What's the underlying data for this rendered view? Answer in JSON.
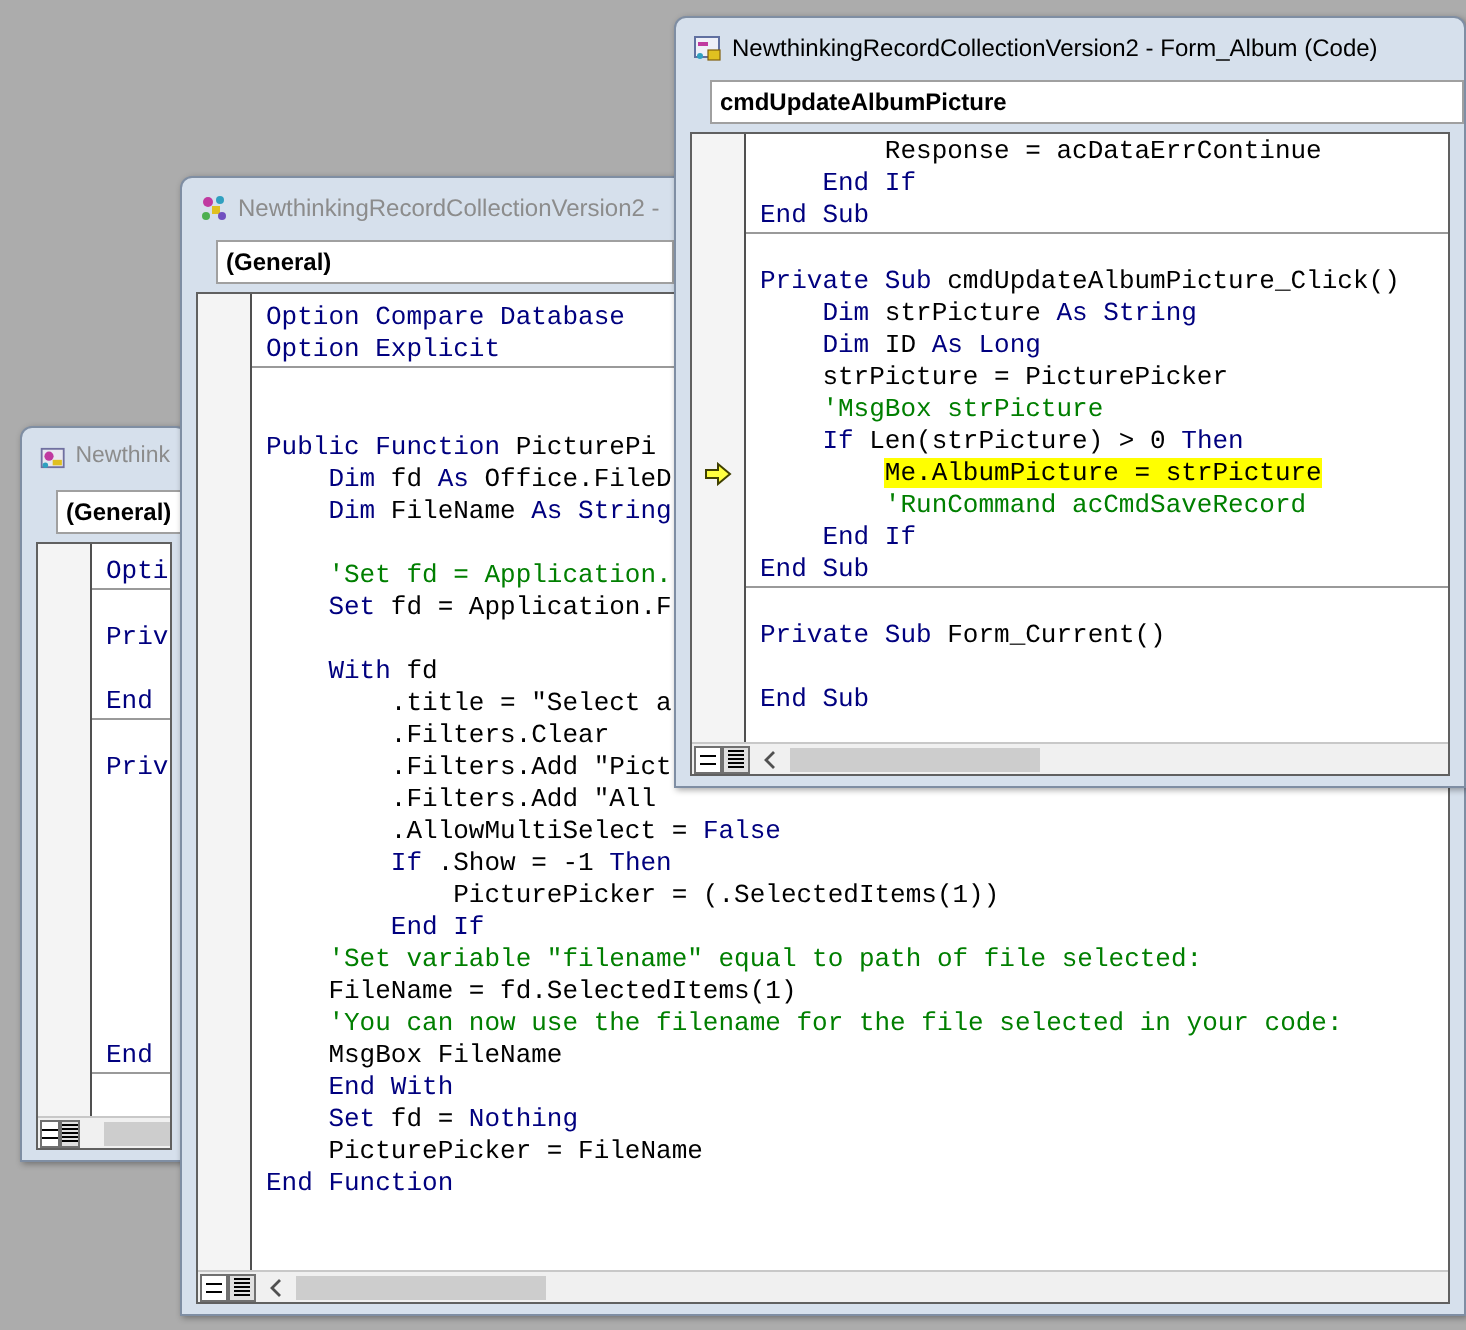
{
  "windows": [
    {
      "title": "Newthink",
      "active": false,
      "dropdown": "(General)",
      "blocks": [
        {
          "lines": [
            {
              "kind": "code",
              "segments": [
                {
                  "kind": "keyword",
                  "text": "Opti"
                }
              ]
            }
          ]
        },
        {
          "lines": [
            {
              "kind": "blank"
            },
            {
              "kind": "code",
              "segments": [
                {
                  "kind": "keyword",
                  "text": "Priv"
                }
              ]
            },
            {
              "kind": "blank"
            },
            {
              "kind": "code",
              "segments": [
                {
                  "kind": "keyword",
                  "text": "End"
                }
              ]
            }
          ]
        },
        {
          "lines": [
            {
              "kind": "blank"
            },
            {
              "kind": "code",
              "segments": [
                {
                  "kind": "keyword",
                  "text": "Priv"
                }
              ]
            },
            {
              "kind": "blank"
            },
            {
              "kind": "blank"
            },
            {
              "kind": "blank"
            },
            {
              "kind": "blank"
            },
            {
              "kind": "blank"
            },
            {
              "kind": "blank"
            },
            {
              "kind": "blank"
            },
            {
              "kind": "blank"
            },
            {
              "kind": "code",
              "segments": [
                {
                  "kind": "keyword",
                  "text": "End"
                }
              ]
            }
          ]
        },
        {
          "lines": [
            {
              "kind": "blank"
            }
          ]
        }
      ]
    },
    {
      "title": "NewthinkingRecordCollectionVersion2 -",
      "active": false,
      "dropdown": "(General)",
      "blocks": [
        {
          "lines": [
            {
              "kind": "code",
              "segments": [
                {
                  "kind": "keyword",
                  "text": "Option Compare Database"
                }
              ]
            },
            {
              "kind": "code",
              "segments": [
                {
                  "kind": "keyword",
                  "text": "Option Explicit"
                }
              ]
            }
          ]
        },
        {
          "lines": [
            {
              "kind": "blank"
            },
            {
              "kind": "blank"
            },
            {
              "kind": "code",
              "segments": [
                {
                  "kind": "keyword",
                  "text": "Public Function"
                },
                {
                  "kind": "plain",
                  "text": " PicturePi"
                }
              ]
            },
            {
              "kind": "code",
              "segments": [
                {
                  "kind": "keyword",
                  "text": "    Dim"
                },
                {
                  "kind": "plain",
                  "text": " fd "
                },
                {
                  "kind": "keyword",
                  "text": "As"
                },
                {
                  "kind": "plain",
                  "text": " Office.FileD"
                }
              ]
            },
            {
              "kind": "code",
              "segments": [
                {
                  "kind": "keyword",
                  "text": "    Dim"
                },
                {
                  "kind": "plain",
                  "text": " FileName "
                },
                {
                  "kind": "keyword",
                  "text": "As String"
                }
              ]
            },
            {
              "kind": "blank"
            },
            {
              "kind": "code",
              "segments": [
                {
                  "kind": "comment",
                  "text": "    'Set fd = Application."
                }
              ]
            },
            {
              "kind": "code",
              "segments": [
                {
                  "kind": "keyword",
                  "text": "    Set"
                },
                {
                  "kind": "plain",
                  "text": " fd = Application.F"
                }
              ]
            },
            {
              "kind": "blank"
            },
            {
              "kind": "code",
              "segments": [
                {
                  "kind": "keyword",
                  "text": "    With"
                },
                {
                  "kind": "plain",
                  "text": " fd"
                }
              ]
            },
            {
              "kind": "code",
              "segments": [
                {
                  "kind": "plain",
                  "text": "        .title = \"Select a"
                }
              ]
            },
            {
              "kind": "code",
              "segments": [
                {
                  "kind": "plain",
                  "text": "        .Filters.Clear"
                }
              ]
            },
            {
              "kind": "code",
              "segments": [
                {
                  "kind": "plain",
                  "text": "        .Filters.Add \"Pict"
                }
              ]
            },
            {
              "kind": "code",
              "segments": [
                {
                  "kind": "plain",
                  "text": "        .Filters.Add \"All"
                }
              ]
            },
            {
              "kind": "code",
              "segments": [
                {
                  "kind": "plain",
                  "text": "        .AllowMultiSelect = "
                },
                {
                  "kind": "keyword",
                  "text": "False"
                }
              ]
            },
            {
              "kind": "code",
              "segments": [
                {
                  "kind": "keyword",
                  "text": "        If"
                },
                {
                  "kind": "plain",
                  "text": " .Show = -1 "
                },
                {
                  "kind": "keyword",
                  "text": "Then"
                }
              ]
            },
            {
              "kind": "code",
              "segments": [
                {
                  "kind": "plain",
                  "text": "            PicturePicker = (.SelectedItems(1))"
                }
              ]
            },
            {
              "kind": "code",
              "segments": [
                {
                  "kind": "keyword",
                  "text": "        End If"
                }
              ]
            },
            {
              "kind": "code",
              "segments": [
                {
                  "kind": "comment",
                  "text": "    'Set variable \"filename\" equal to path of file selected:"
                }
              ]
            },
            {
              "kind": "code",
              "segments": [
                {
                  "kind": "plain",
                  "text": "    FileName = fd.SelectedItems(1)"
                }
              ]
            },
            {
              "kind": "code",
              "segments": [
                {
                  "kind": "comment",
                  "text": "    'You can now use the filename for the file selected in your code:"
                }
              ]
            },
            {
              "kind": "code",
              "segments": [
                {
                  "kind": "plain",
                  "text": "    MsgBox FileName"
                }
              ]
            },
            {
              "kind": "code",
              "segments": [
                {
                  "kind": "keyword",
                  "text": "    End With"
                }
              ]
            },
            {
              "kind": "code",
              "segments": [
                {
                  "kind": "keyword",
                  "text": "    Set"
                },
                {
                  "kind": "plain",
                  "text": " fd = "
                },
                {
                  "kind": "keyword",
                  "text": "Nothing"
                }
              ]
            },
            {
              "kind": "code",
              "segments": [
                {
                  "kind": "plain",
                  "text": "    PicturePicker = FileName"
                }
              ]
            },
            {
              "kind": "code",
              "segments": [
                {
                  "kind": "keyword",
                  "text": "End Function"
                }
              ]
            }
          ]
        }
      ]
    },
    {
      "title": "NewthinkingRecordCollectionVersion2 - Form_Album (Code)",
      "active": true,
      "dropdown": "cmdUpdateAlbumPicture",
      "blocks": [
        {
          "lines": [
            {
              "kind": "code",
              "segments": [
                {
                  "kind": "plain",
                  "text": "        Response = acDataErrContinue"
                }
              ]
            },
            {
              "kind": "code",
              "segments": [
                {
                  "kind": "keyword",
                  "text": "    End If"
                }
              ]
            },
            {
              "kind": "code",
              "segments": [
                {
                  "kind": "keyword",
                  "text": "End Sub"
                }
              ]
            }
          ]
        },
        {
          "lines": [
            {
              "kind": "blank"
            },
            {
              "kind": "code",
              "segments": [
                {
                  "kind": "keyword",
                  "text": "Private Sub"
                },
                {
                  "kind": "plain",
                  "text": " cmdUpdateAlbumPicture_Click()"
                }
              ]
            },
            {
              "kind": "code",
              "segments": [
                {
                  "kind": "keyword",
                  "text": "    Dim"
                },
                {
                  "kind": "plain",
                  "text": " strPicture "
                },
                {
                  "kind": "keyword",
                  "text": "As String"
                }
              ]
            },
            {
              "kind": "code",
              "segments": [
                {
                  "kind": "keyword",
                  "text": "    Dim"
                },
                {
                  "kind": "plain",
                  "text": " ID "
                },
                {
                  "kind": "keyword",
                  "text": "As Long"
                }
              ]
            },
            {
              "kind": "code",
              "segments": [
                {
                  "kind": "plain",
                  "text": "    strPicture = PicturePicker"
                }
              ]
            },
            {
              "kind": "code",
              "segments": [
                {
                  "kind": "comment",
                  "text": "    'MsgBox strPicture"
                }
              ]
            },
            {
              "kind": "code",
              "segments": [
                {
                  "kind": "keyword",
                  "text": "    If"
                },
                {
                  "kind": "plain",
                  "text": " Len(strPicture) > 0 "
                },
                {
                  "kind": "keyword",
                  "text": "Then"
                }
              ]
            },
            {
              "kind": "code",
              "current": true,
              "segments": [
                {
                  "kind": "plain",
                  "text": "        Me.AlbumPicture = strPicture"
                }
              ]
            },
            {
              "kind": "code",
              "segments": [
                {
                  "kind": "comment",
                  "text": "        'RunCommand acCmdSaveRecord"
                }
              ]
            },
            {
              "kind": "code",
              "segments": [
                {
                  "kind": "keyword",
                  "text": "    End If"
                }
              ]
            },
            {
              "kind": "code",
              "segments": [
                {
                  "kind": "keyword",
                  "text": "End Sub"
                }
              ]
            }
          ]
        },
        {
          "lines": [
            {
              "kind": "blank"
            },
            {
              "kind": "code",
              "segments": [
                {
                  "kind": "keyword",
                  "text": "Private Sub"
                },
                {
                  "kind": "plain",
                  "text": " Form_Current()"
                }
              ]
            },
            {
              "kind": "blank"
            },
            {
              "kind": "code",
              "segments": [
                {
                  "kind": "keyword",
                  "text": "End Sub"
                }
              ]
            }
          ]
        }
      ]
    }
  ]
}
